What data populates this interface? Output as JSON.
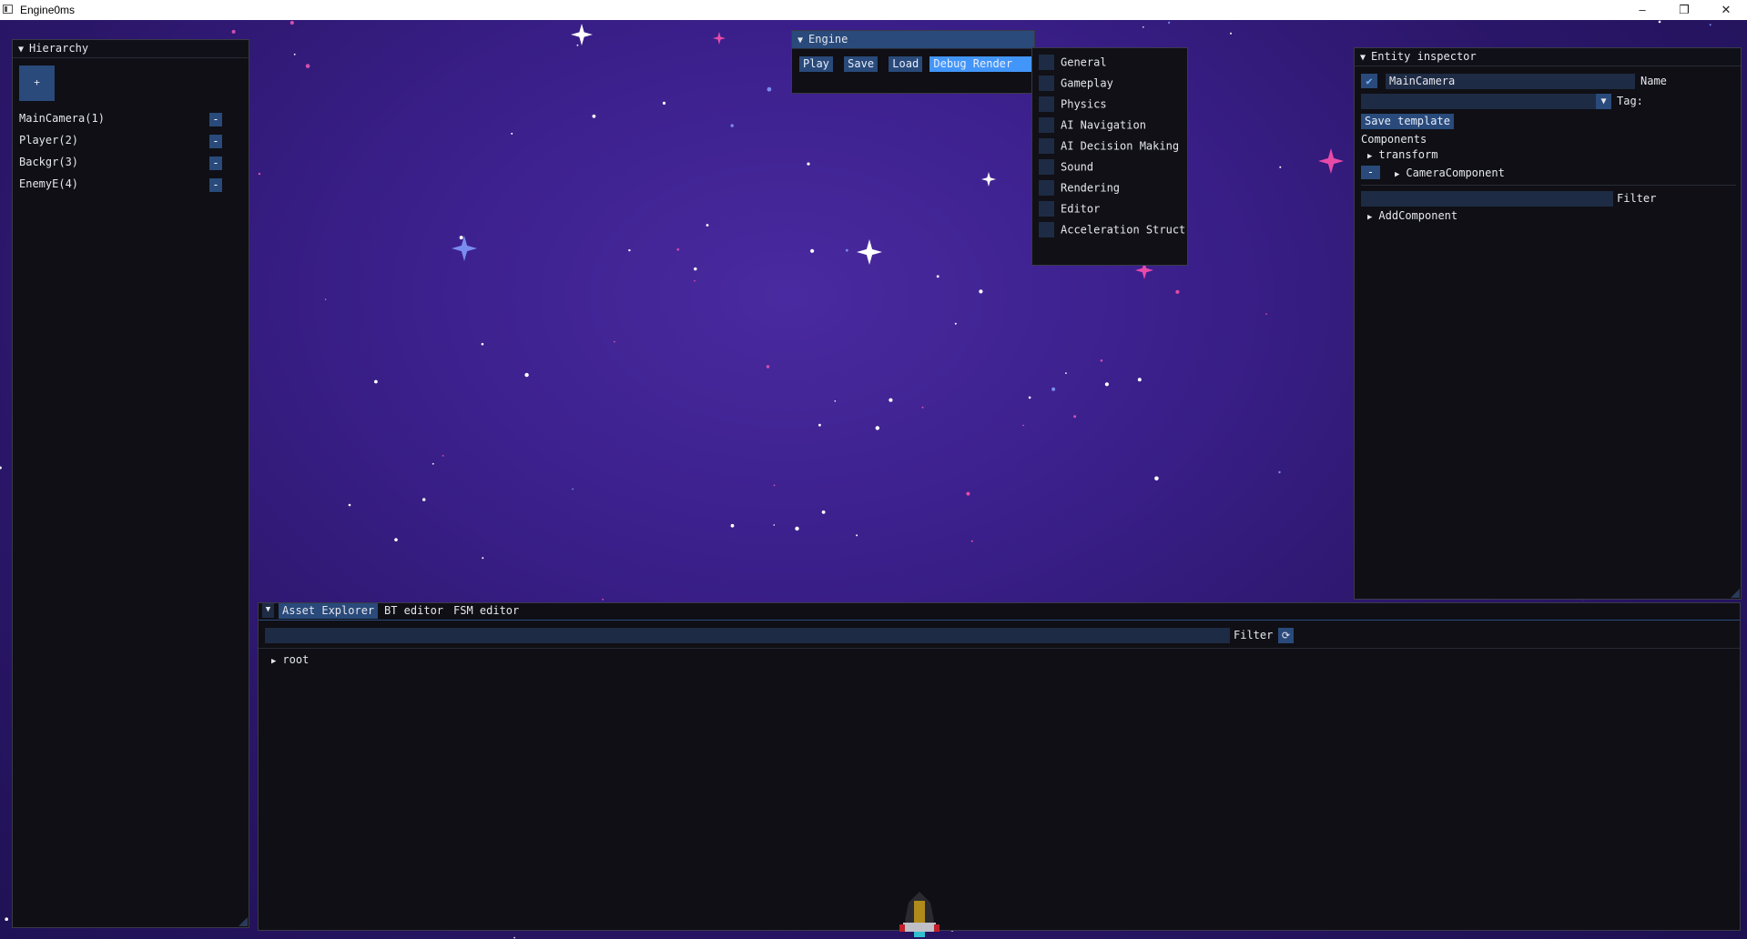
{
  "window": {
    "title": "Engine0ms",
    "controls": {
      "minimize": "–",
      "maximize": "❐",
      "close": "✕"
    }
  },
  "hierarchy": {
    "title": "Hierarchy",
    "add_label": "+",
    "items": [
      {
        "label": "MainCamera(1)",
        "remove": "-"
      },
      {
        "label": "Player(2)",
        "remove": "-"
      },
      {
        "label": "Backgr(3)",
        "remove": "-"
      },
      {
        "label": "EnemyE(4)",
        "remove": "-"
      }
    ]
  },
  "engine": {
    "title": "Engine",
    "buttons": {
      "play": "Play",
      "save": "Save",
      "load": "Load",
      "debug_render": "Debug Render"
    }
  },
  "debug_menu": {
    "items": [
      "General",
      "Gameplay",
      "Physics",
      "AI Navigation",
      "AI Decision Making",
      "Sound",
      "Rendering",
      "Editor",
      "Acceleration Struct"
    ]
  },
  "inspector": {
    "title": "Entity inspector",
    "name_value": "MainCamera",
    "name_label": "Name",
    "tag_label": "Tag:",
    "save_template": "Save template",
    "components_label": "Components",
    "transform": "transform",
    "camera_component": "CameraComponent",
    "camera_remove": "-",
    "filter_label": "Filter",
    "add_component": "AddComponent"
  },
  "bottom": {
    "tabs": [
      "Asset Explorer",
      "BT editor",
      "FSM editor"
    ],
    "filter_label": "Filter",
    "tree_root": "root"
  },
  "colors": {
    "accent": "#294a7a",
    "accent_active": "#4296fa",
    "panel_bg": "#0f0f15",
    "space_bg": "#3a1f8a"
  }
}
